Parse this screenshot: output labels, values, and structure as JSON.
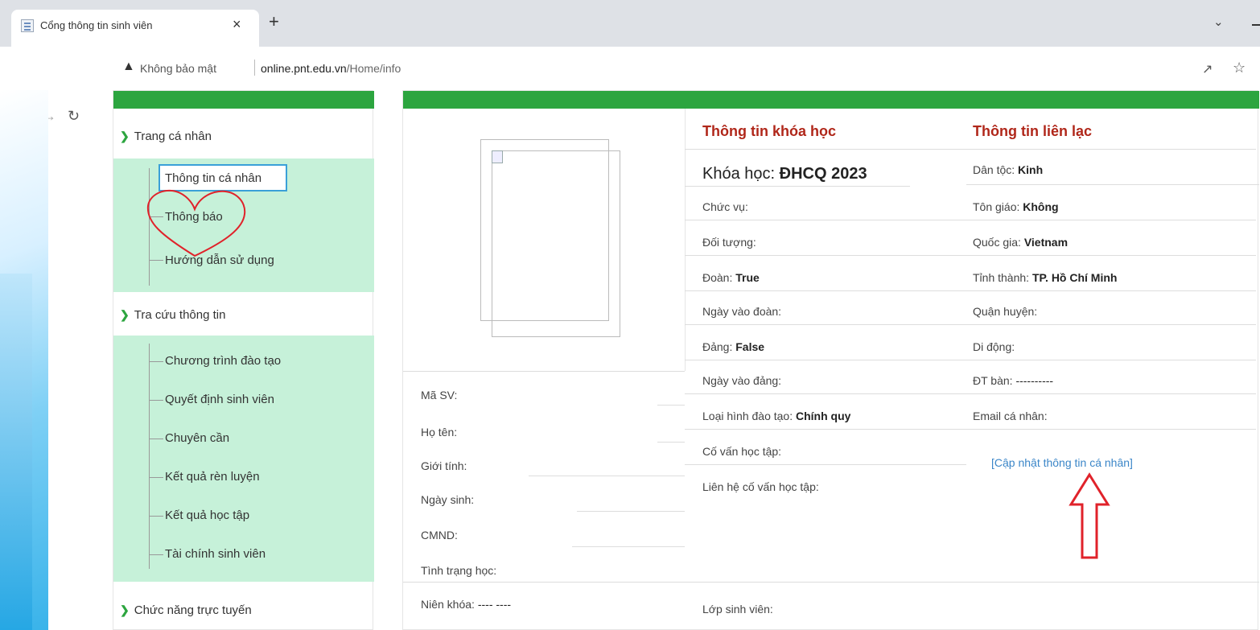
{
  "browser": {
    "tab_title": "Cổng thông tin sinh viên",
    "tab_close": "×",
    "new_tab": "+",
    "security_label": "Không bảo mật",
    "url_domain": "online.pnt.edu.vn",
    "url_path": "/Home/info"
  },
  "sidebar": {
    "sections": [
      {
        "title": "Trang cá nhân",
        "items": [
          "Thông tin cá nhân",
          "Thông báo",
          "Hướng dẫn sử dụng"
        ]
      },
      {
        "title": "Tra cứu thông tin",
        "items": [
          "Chương trình đào tạo",
          "Quyết định sinh viên",
          "Chuyên cần",
          "Kết quả rèn luyện",
          "Kết quả học tập",
          "Tài chính sinh viên"
        ]
      },
      {
        "title": "Chức năng trực tuyến",
        "items": []
      }
    ]
  },
  "profile": {
    "left_fields": [
      {
        "label": "Mã SV:",
        "value": ""
      },
      {
        "label": "Họ tên:",
        "value": ""
      },
      {
        "label": "Giới tính:",
        "value": ""
      },
      {
        "label": "Ngày sinh:",
        "value": ""
      },
      {
        "label": "CMND:",
        "value": ""
      },
      {
        "label": "Tình trạng học:",
        "value": ""
      },
      {
        "label": "Niên khóa:",
        "value": "---- ----"
      }
    ],
    "course_heading": "Thông tin khóa học",
    "course_label": "Khóa học:",
    "course_value": "ĐHCQ 2023",
    "course_fields": [
      {
        "label": "Chức vụ:",
        "value": ""
      },
      {
        "label": "Đối tượng:",
        "value": ""
      },
      {
        "label": "Đoàn:",
        "value": "True"
      },
      {
        "label": "Ngày vào đoàn:",
        "value": ""
      },
      {
        "label": "Đảng:",
        "value": "False"
      },
      {
        "label": "Ngày vào đảng:",
        "value": ""
      },
      {
        "label": "Loại hình đào tạo:",
        "value": "Chính quy"
      },
      {
        "label": "Cố vấn học tập:",
        "value": ""
      },
      {
        "label": "Liên hệ cố vấn học tập:",
        "value": ""
      }
    ],
    "contact_heading": "Thông tin liên lạc",
    "contact_fields": [
      {
        "label": "Dân tộc:",
        "value": "Kinh"
      },
      {
        "label": "Tôn giáo:",
        "value": "Không"
      },
      {
        "label": "Quốc gia:",
        "value": "Vietnam"
      },
      {
        "label": "Tỉnh thành:",
        "value": "TP. Hồ Chí Minh"
      },
      {
        "label": "Quận huyện:",
        "value": ""
      },
      {
        "label": "Di động:",
        "value": ""
      },
      {
        "label": "ĐT bàn:",
        "value": "----------"
      },
      {
        "label": "Email cá nhân:",
        "value": ""
      }
    ],
    "update_link": "[Cập nhật thông tin cá nhân]",
    "class_label": "Lớp sinh viên:"
  },
  "colors": {
    "accent_green": "#2ca53f",
    "heading_red": "#b0271a",
    "annotation_red": "#e0222a",
    "link_blue": "#3b86c8"
  }
}
